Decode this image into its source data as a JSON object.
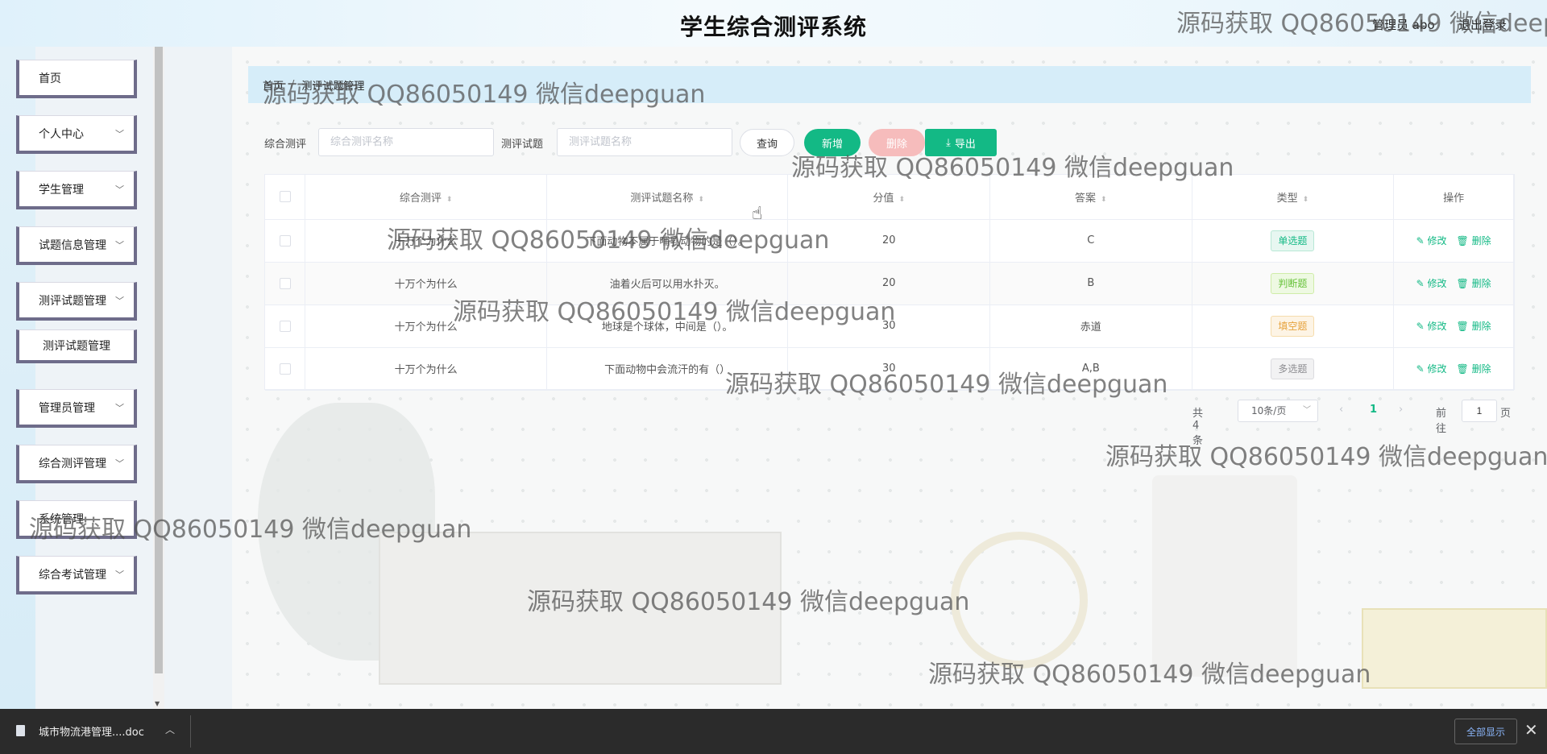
{
  "header": {
    "title": "学生综合测评系统",
    "user_label": "管理员 abo",
    "logout": "退出登录"
  },
  "sidebar": {
    "items": [
      {
        "label": "首页",
        "has_arrow": false
      },
      {
        "label": "个人中心",
        "has_arrow": true
      },
      {
        "label": "学生管理",
        "has_arrow": true
      },
      {
        "label": "试题信息管理",
        "has_arrow": true
      },
      {
        "label": "测评试题管理",
        "has_arrow": true
      },
      {
        "label": "管理员管理",
        "has_arrow": true
      },
      {
        "label": "综合测评管理",
        "has_arrow": true
      },
      {
        "label": "系统管理",
        "has_arrow": false
      },
      {
        "label": "综合考试管理",
        "has_arrow": true
      }
    ],
    "submenu": {
      "label": "测评试题管理"
    }
  },
  "breadcrumb": {
    "home": "首页",
    "separator": "/",
    "current": "测评试题管理"
  },
  "search": {
    "field1_label": "综合测评",
    "field1_placeholder": "综合测评名称",
    "field2_label": "测评试题",
    "field2_placeholder": "测评试题名称",
    "query_button": "查询",
    "add_button": "新增",
    "delete_button": "删除",
    "export_button": "导出"
  },
  "table": {
    "columns": [
      "综合测评",
      "测评试题名称",
      "分值",
      "答案",
      "类型",
      "操作"
    ],
    "rows": [
      {
        "assessment": "十万个为什么",
        "question": "下面动物不属于哺乳动物的是（）。",
        "score": "20",
        "answer": "C",
        "type": "单选题",
        "type_color": "green"
      },
      {
        "assessment": "十万个为什么",
        "question": "油着火后可以用水扑灭。",
        "score": "20",
        "answer": "B",
        "type": "判断题",
        "type_color": "lime"
      },
      {
        "assessment": "十万个为什么",
        "question": "地球是个球体，中间是（）。",
        "score": "30",
        "answer": "赤道",
        "type": "填空题",
        "type_color": "orange"
      },
      {
        "assessment": "十万个为什么",
        "question": "下面动物中会流汗的有（）",
        "score": "30",
        "answer": "A,B",
        "type": "多选题",
        "type_color": "gray"
      }
    ],
    "edit_label": "修改",
    "delete_label": "删除"
  },
  "pagination": {
    "total": "共 4 条",
    "page_size": "10条/页",
    "current_page": "1",
    "goto_label": "前往",
    "goto_value": "1",
    "page_suffix": "页"
  },
  "download_bar": {
    "file_name": "城市物流港管理....doc",
    "show_all": "全部显示"
  },
  "watermark": "源码获取 QQ86050149 微信deepguan",
  "colors": {
    "accent": "#13b985",
    "danger_light": "#f6bcbc",
    "sidebar_border": "#6e6c8a",
    "breadcrumb_bg": "#d6edf9"
  }
}
